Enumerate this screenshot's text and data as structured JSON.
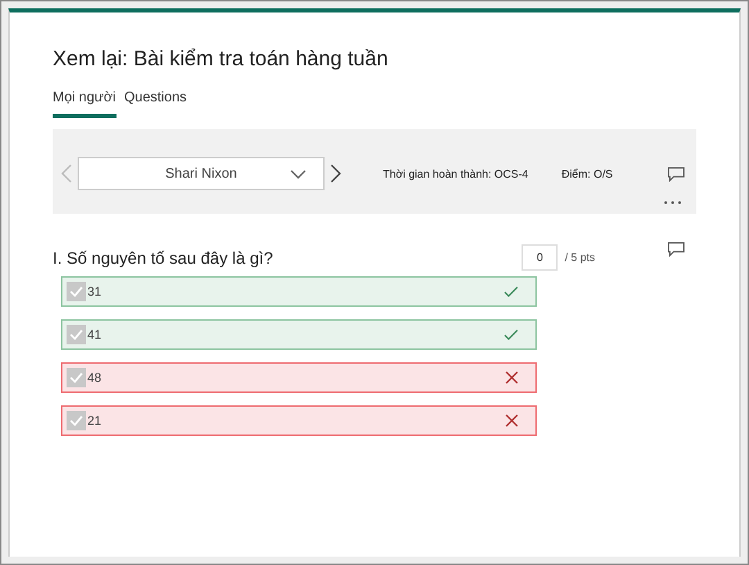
{
  "title": "Xem lại: Bài kiểm tra toán hàng tuần",
  "tabs": [
    {
      "label": "Mọi người",
      "selected": true
    },
    {
      "label": "Questions",
      "selected": false
    }
  ],
  "respondent": {
    "name": "Shari Nixon",
    "completion": "Thời gian hoàn thành: OCS-4",
    "score": "Điểm: O/S"
  },
  "question": {
    "title": "I. Số nguyên tố sau đây là gì?",
    "points_value": "0",
    "points_total": "/ 5 pts",
    "options": [
      {
        "label": "31",
        "checked": true,
        "kind": "correct"
      },
      {
        "label": "41",
        "checked": true,
        "kind": "correct"
      },
      {
        "label": "48",
        "checked": true,
        "kind": "incorrect"
      },
      {
        "label": "21",
        "checked": true,
        "kind": "incorrect"
      }
    ]
  }
}
